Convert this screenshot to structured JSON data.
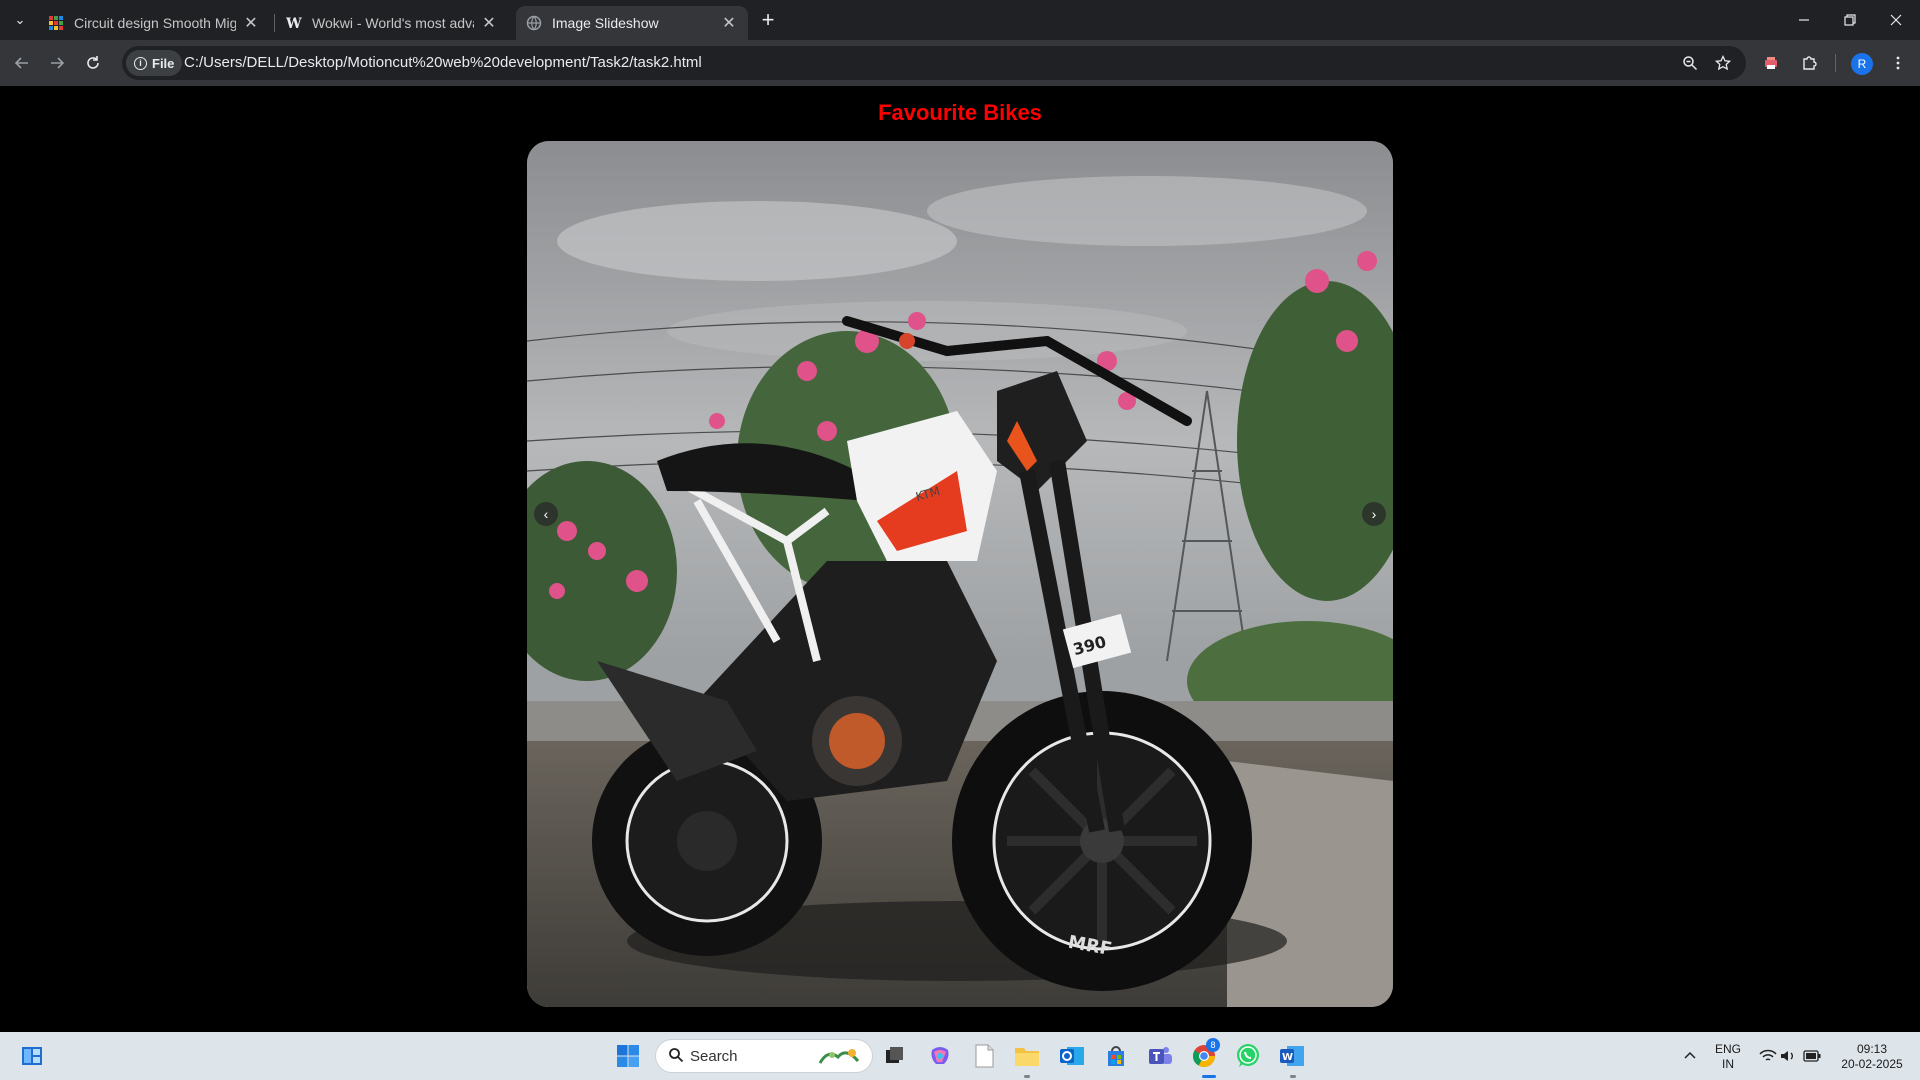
{
  "browser": {
    "tabs": [
      {
        "title": "Circuit design Smooth Migelo -",
        "active": false
      },
      {
        "title": "Wokwi - World's most advanced",
        "active": false
      },
      {
        "title": "Image Slideshow",
        "active": true
      }
    ],
    "new_tab_label": "+",
    "address": {
      "scheme_chip": "File",
      "url": "C:/Users/DELL/Desktop/Motioncut%20web%20development/Task2/task2.html"
    },
    "profile_initial": "R"
  },
  "page": {
    "heading": "Favourite Bikes",
    "heading_color": "#ff0000",
    "slide_prev_label": "‹",
    "slide_next_label": "›",
    "slide_image_fork_label": "390",
    "slide_image_tyre_label": "MRF",
    "slide_image_brand_label": "KTM"
  },
  "taskbar": {
    "search_placeholder": "Search",
    "language_top": "ENG",
    "language_bottom": "IN",
    "time": "09:13",
    "date": "20-02-2025",
    "chrome_badge": "8"
  },
  "icons": {
    "tab_menu": "chevron-down-icon",
    "back": "arrow-left-icon",
    "forward": "arrow-right-icon",
    "reload": "reload-icon",
    "zoom": "zoom-icon",
    "bookmark": "star-icon",
    "extensions": "puzzle-icon"
  }
}
